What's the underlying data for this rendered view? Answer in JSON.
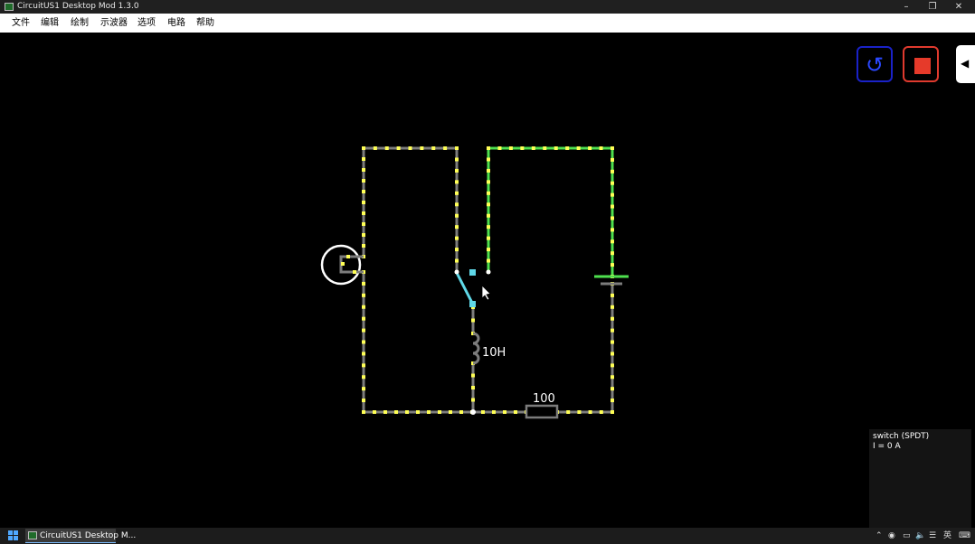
{
  "window": {
    "title": "CircuitUS1 Desktop Mod 1.3.0"
  },
  "menu": {
    "items": [
      "文件",
      "编辑",
      "绘制",
      "示波器",
      "选项",
      "电路",
      "帮助"
    ]
  },
  "controls": {
    "reset_icon": "reset-icon",
    "stop_icon": "stop-icon",
    "toggle_icon": "collapse-left-icon"
  },
  "circuit": {
    "inductor_label": "10H",
    "resistor_label": "100",
    "colors": {
      "wire": "#7c7c7c",
      "dot": "#ffff55",
      "active": "#4ee04e",
      "switch": "#5fd8e8"
    }
  },
  "info": {
    "line1": "switch (SPDT)",
    "line2": "I = 0 A"
  },
  "taskbar": {
    "app_label": "CircuitUS1 Desktop M...",
    "ime": "英"
  }
}
